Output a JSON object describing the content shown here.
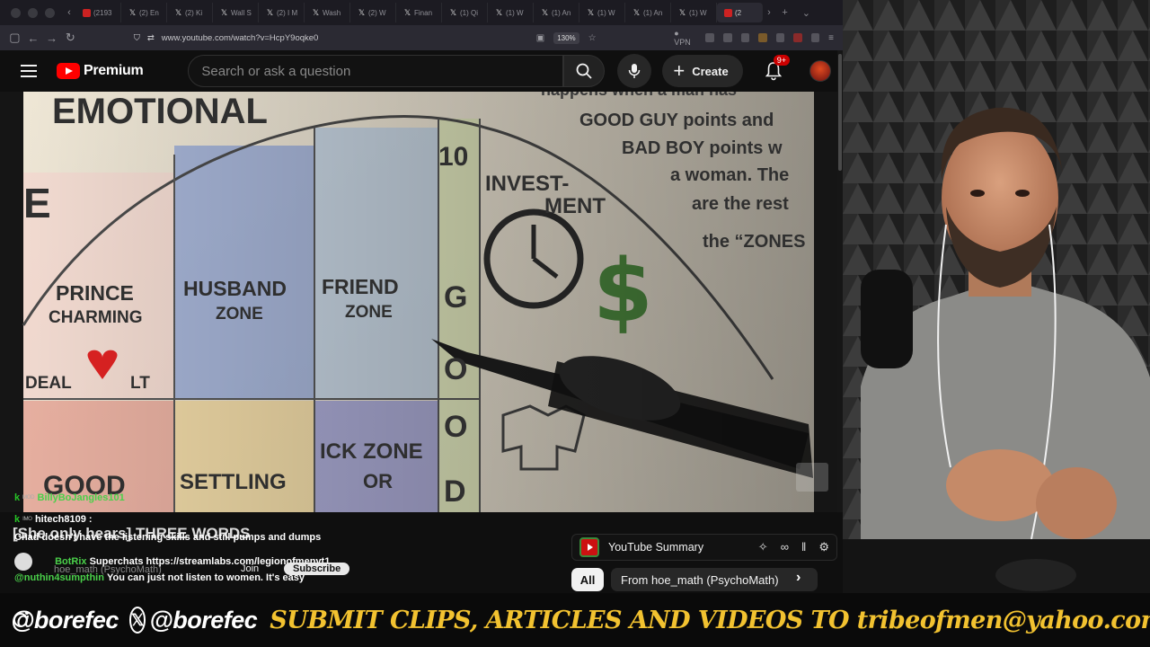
{
  "browser": {
    "tabs": [
      {
        "label": "(2193",
        "favicon": "youtube-favicon"
      },
      {
        "label": "(2) En",
        "favicon": "x-favicon"
      },
      {
        "label": "(2) Ki",
        "favicon": "x-favicon"
      },
      {
        "label": "Wall S",
        "favicon": "x-favicon"
      },
      {
        "label": "(2) I M",
        "favicon": "x-favicon"
      },
      {
        "label": "Wash",
        "favicon": "x-favicon"
      },
      {
        "label": "(2) W",
        "favicon": "x-favicon"
      },
      {
        "label": "Finan",
        "favicon": "x-favicon"
      },
      {
        "label": "(1) Qi",
        "favicon": "x-favicon"
      },
      {
        "label": "(1) W",
        "favicon": "x-favicon"
      },
      {
        "label": "(1) An",
        "favicon": "x-favicon"
      },
      {
        "label": "(1) W",
        "favicon": "x-favicon"
      },
      {
        "label": "(1) An",
        "favicon": "x-favicon"
      },
      {
        "label": "(1) W",
        "favicon": "x-favicon"
      },
      {
        "label": "(2",
        "favicon": "youtube-favicon",
        "active": true
      }
    ],
    "url": "www.youtube.com/watch?v=HcpY9oqke0",
    "zoom": "130%",
    "vpn_label": "VPN"
  },
  "youtube": {
    "logo_text": "Premium",
    "search_placeholder": "Search or ask a question",
    "create_label": "Create",
    "notifications_badge": "9+"
  },
  "video_chart": {
    "emotional": "EMOTIONAL",
    "happens": "happens when a man has",
    "good_guy": "GOOD GUY points and",
    "bad_boy": "BAD BOY points w",
    "a_woman": "a woman. The",
    "are_the": "are the rest",
    "zones": "the “ZONES",
    "ten": "10",
    "investment": "INVEST-\nMENT",
    "prince": "PRINCE\nCHARMING",
    "husband": "HUSBAND\nZONE",
    "friend": "FRIEND\nZONE",
    "good_vertical": "G O O D",
    "deal": "DEAL",
    "lt": "LT",
    "good_bottom": "GOOD",
    "settling": "SETTLING",
    "ick": "ICK ZONE\nOR\nGOLD",
    "edge_e": "E"
  },
  "chat": {
    "messages": [
      {
        "user": "BillyBoJangles101",
        "text": ""
      },
      {
        "user": "hitech8109",
        "text": ""
      },
      {
        "user": "",
        "text": "Chad doesn't have the listening skills and still pumps and dumps"
      },
      {
        "user": "BotRix",
        "text": "Superchats https://streamlabs.com/legionofmenyt1"
      },
      {
        "user": "@nuthin4sumpthin",
        "text": "You can just not listen to women. It's easy"
      }
    ],
    "overlay_title": "[She only hears] THREE WORDS",
    "channel_fragment": "hoe_math (PsychoMath)",
    "join_label": "Join",
    "subscribe_label": "Subscribe"
  },
  "summary_bar": {
    "title": "YouTube Summary",
    "chip_all": "All",
    "chip_from": "From hoe_math (PsychoMath)"
  },
  "footer": {
    "instagram_handle": "@borefec",
    "x_handle": "@borefec",
    "submit_text": "SUBMIT CLIPS, ARTICLES AND VIDEOS TO tribeofmen@yahoo.com"
  },
  "colors": {
    "youtube_red": "#ff0000",
    "footer_yellow": "#f2c230",
    "chat_green": "#27c427"
  }
}
